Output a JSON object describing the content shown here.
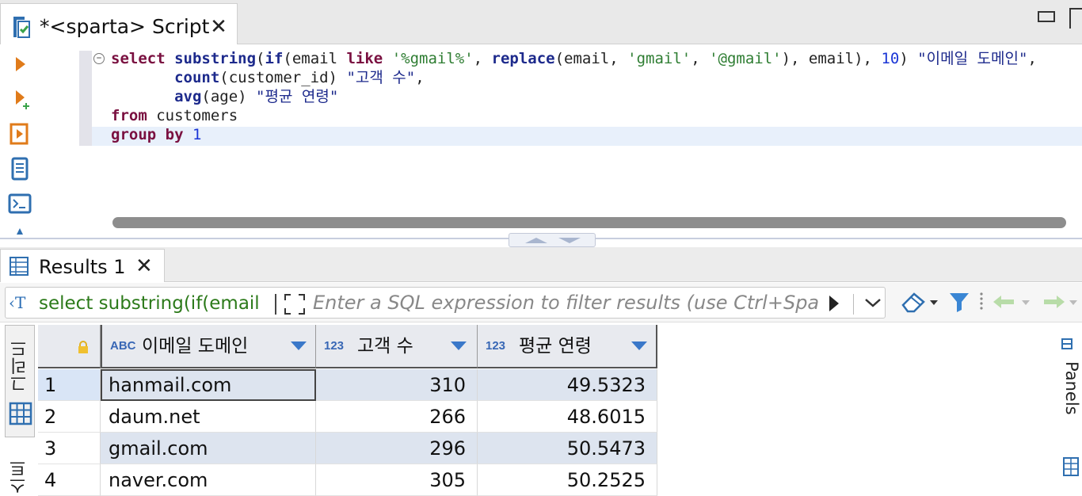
{
  "editor_tab": {
    "title": "*<sparta> Script",
    "close": "✕"
  },
  "sql": {
    "line1": {
      "kw_select": "select",
      "fn_substring": "substring",
      "p1": "(",
      "kw_if": "if",
      "p2": "(email ",
      "kw_like": "like",
      "sp1": " ",
      "s_like": "'%gmail%'",
      "p3": ", ",
      "fn_replace": "replace",
      "p4": "(email, ",
      "s_gmail": "'gmail'",
      "p5": ", ",
      "s_at_gmail": "'@gmail'",
      "p6": "), email), ",
      "n10": "10",
      "p7": ") ",
      "alias1": "\"이메일 도메인\"",
      "p8": ","
    },
    "line2": {
      "indent": "       ",
      "fn_count": "count",
      "p1": "(customer_id) ",
      "alias2": "\"고객 수\"",
      "p2": ","
    },
    "line3": {
      "indent": "       ",
      "fn_avg": "avg",
      "p1": "(age) ",
      "alias3": "\"평균 연령\""
    },
    "line4": {
      "kw_from": "from",
      "table": " customers"
    },
    "line5": {
      "kw_group_by": "group by",
      "sp": " ",
      "n1": "1"
    }
  },
  "results_tab": {
    "title": "Results 1",
    "close": "✕"
  },
  "filter": {
    "source_icon": "‹T",
    "source_label": "select substring(if(email",
    "placeholder": "Enter a SQL expression to filter results (use Ctrl+Spa"
  },
  "side_tabs": {
    "grid": "그리드",
    "text": "스트"
  },
  "right_panel_label": "Panels",
  "grid": {
    "columns": [
      {
        "type": "ABC",
        "label": "이메일 도메인"
      },
      {
        "type": "123",
        "label": "고객 수"
      },
      {
        "type": "123",
        "label": "평균 연령"
      }
    ],
    "rows": [
      {
        "idx": "1",
        "domain": "hanmail.com",
        "count": "310",
        "avg": "49.5323"
      },
      {
        "idx": "2",
        "domain": "daum.net",
        "count": "266",
        "avg": "48.6015"
      },
      {
        "idx": "3",
        "domain": "gmail.com",
        "count": "296",
        "avg": "50.5473"
      },
      {
        "idx": "4",
        "domain": "naver.com",
        "count": "305",
        "avg": "50.2525"
      }
    ]
  },
  "colors": {
    "keyword": "#7a1040",
    "function": "#1d2a8c",
    "string": "#2e7d32",
    "number": "#1a35d6",
    "accent": "#3a78c9",
    "source_label": "#2c7a1a"
  }
}
